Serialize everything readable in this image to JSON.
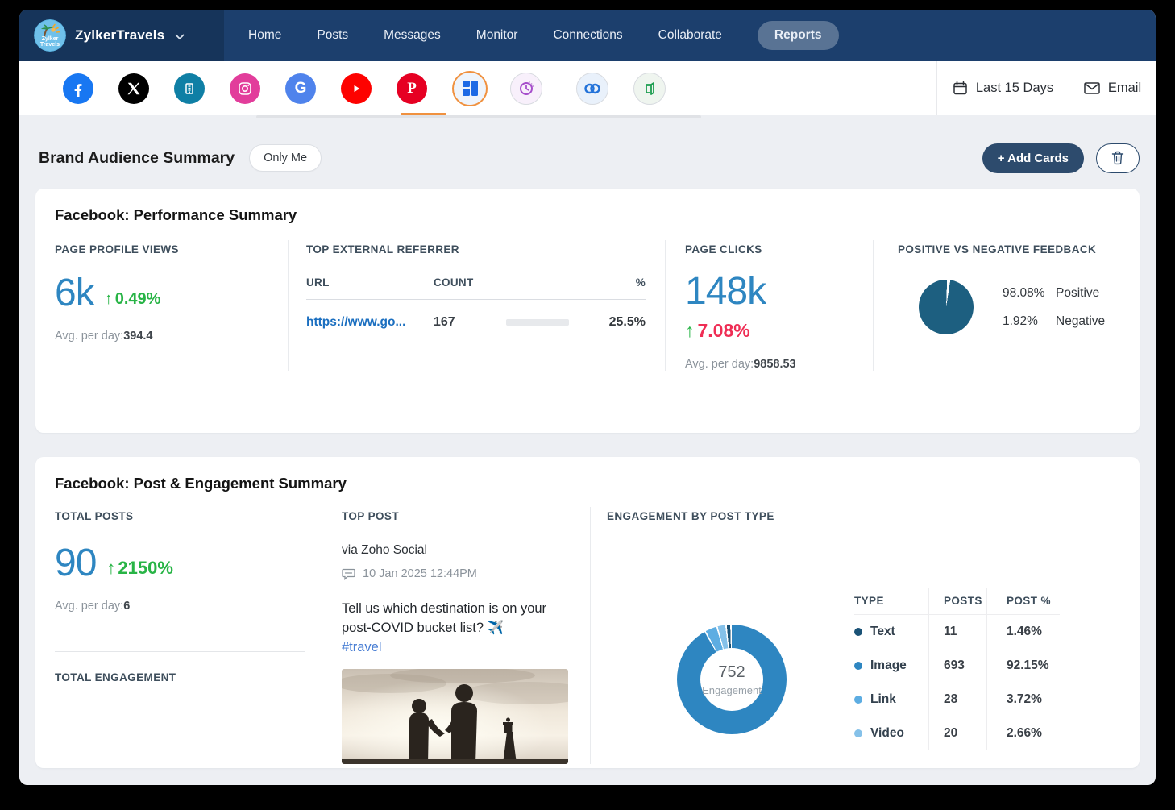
{
  "nav": {
    "brand_name": "ZylkerTravels",
    "items": [
      {
        "label": "Home"
      },
      {
        "label": "Posts"
      },
      {
        "label": "Messages"
      },
      {
        "label": "Monitor"
      },
      {
        "label": "Connections"
      },
      {
        "label": "Collaborate"
      },
      {
        "label": "Reports"
      }
    ],
    "active_item": "Reports"
  },
  "channel_bar": {
    "icons": [
      "facebook",
      "x-twitter",
      "company-page",
      "instagram",
      "google-business",
      "youtube",
      "pinterest",
      "all-channels-selected",
      "schedule",
      "zoho-crm",
      "zoho-desk"
    ],
    "date_range_label": "Last 15 Days",
    "email_label": "Email"
  },
  "header": {
    "title": "Brand Audience Summary",
    "visibility_label": "Only Me",
    "add_cards_label": "+ Add Cards"
  },
  "performance": {
    "title": "Facebook: Performance Summary",
    "profile_views": {
      "label": "PAGE PROFILE VIEWS",
      "value": "6k",
      "change_arrow": "↑",
      "change": "0.49%",
      "avg_label": "Avg. per day:",
      "avg_value": "394.4"
    },
    "referrer": {
      "label": "TOP EXTERNAL REFERRER",
      "col_url": "URL",
      "col_count": "COUNT",
      "col_pct": "%",
      "row": {
        "url": "https://www.go...",
        "count": "167",
        "pct": "25.5%",
        "bar_pct": 25.5
      }
    },
    "page_clicks": {
      "label": "PAGE CLICKS",
      "value": "148k",
      "change_arrow": "↑",
      "change": "7.08%",
      "avg_label": "Avg. per day:",
      "avg_value": "9858.53"
    },
    "feedback": {
      "label": "POSITIVE VS NEGATIVE FEEDBACK",
      "positive_pct": "98.08%",
      "positive_label": "Positive",
      "negative_pct": "1.92%",
      "negative_label": "Negative"
    }
  },
  "engagement": {
    "title": "Facebook: Post & Engagement Summary",
    "total_posts": {
      "label": "TOTAL POSTS",
      "value": "90",
      "change_arrow": "↑",
      "change": "2150%",
      "avg_label": "Avg. per day:",
      "avg_value": "6"
    },
    "total_engagement": {
      "label": "TOTAL ENGAGEMENT"
    },
    "top_post": {
      "label": "TOP POST",
      "via": "via Zoho Social",
      "date": "10 Jan 2025 12:44PM",
      "text": "Tell us which destination is on your post-COVID bucket list? ✈️",
      "hashtag": "#travel"
    },
    "by_post_type": {
      "label": "ENGAGEMENT BY POST TYPE",
      "center_value": "752",
      "center_label": "Engagement",
      "col_type": "TYPE",
      "col_posts": "POSTS",
      "col_pct": "POST %",
      "rows": [
        {
          "type": "Text",
          "posts": "11",
          "pct": "1.46%",
          "color": "#1a5276"
        },
        {
          "type": "Image",
          "posts": "693",
          "pct": "92.15%",
          "color": "#2e86c1"
        },
        {
          "type": "Link",
          "posts": "28",
          "pct": "3.72%",
          "color": "#5dade2"
        },
        {
          "type": "Video",
          "posts": "20",
          "pct": "2.66%",
          "color": "#85c1e9"
        }
      ]
    }
  },
  "colors": {
    "accent_blue": "#2e86c1",
    "positive_green": "#28b446",
    "negative_red": "#ef2e55",
    "pie_teal": "#1d5f80",
    "brand_navy": "#2d4b6d",
    "selected_orange": "#f0913f"
  },
  "chart_data": [
    {
      "name": "feedback_pie",
      "type": "pie",
      "title": "POSITIVE VS NEGATIVE FEEDBACK",
      "labels": [
        "Positive",
        "Negative"
      ],
      "values": [
        98.08,
        1.92
      ],
      "colors": [
        "#1d5f80",
        "#ffffff"
      ],
      "legend_position": "right"
    },
    {
      "name": "engagement_donut",
      "type": "donut",
      "title": "ENGAGEMENT BY POST TYPE",
      "center_value": 752,
      "center_label": "Engagement",
      "labels": [
        "Image",
        "Link",
        "Video",
        "Text"
      ],
      "values": [
        92.15,
        3.72,
        2.66,
        1.46
      ],
      "colors": [
        "#2e86c1",
        "#5dade2",
        "#85c1e9",
        "#1a5276"
      ],
      "legend_position": "right-table"
    }
  ]
}
